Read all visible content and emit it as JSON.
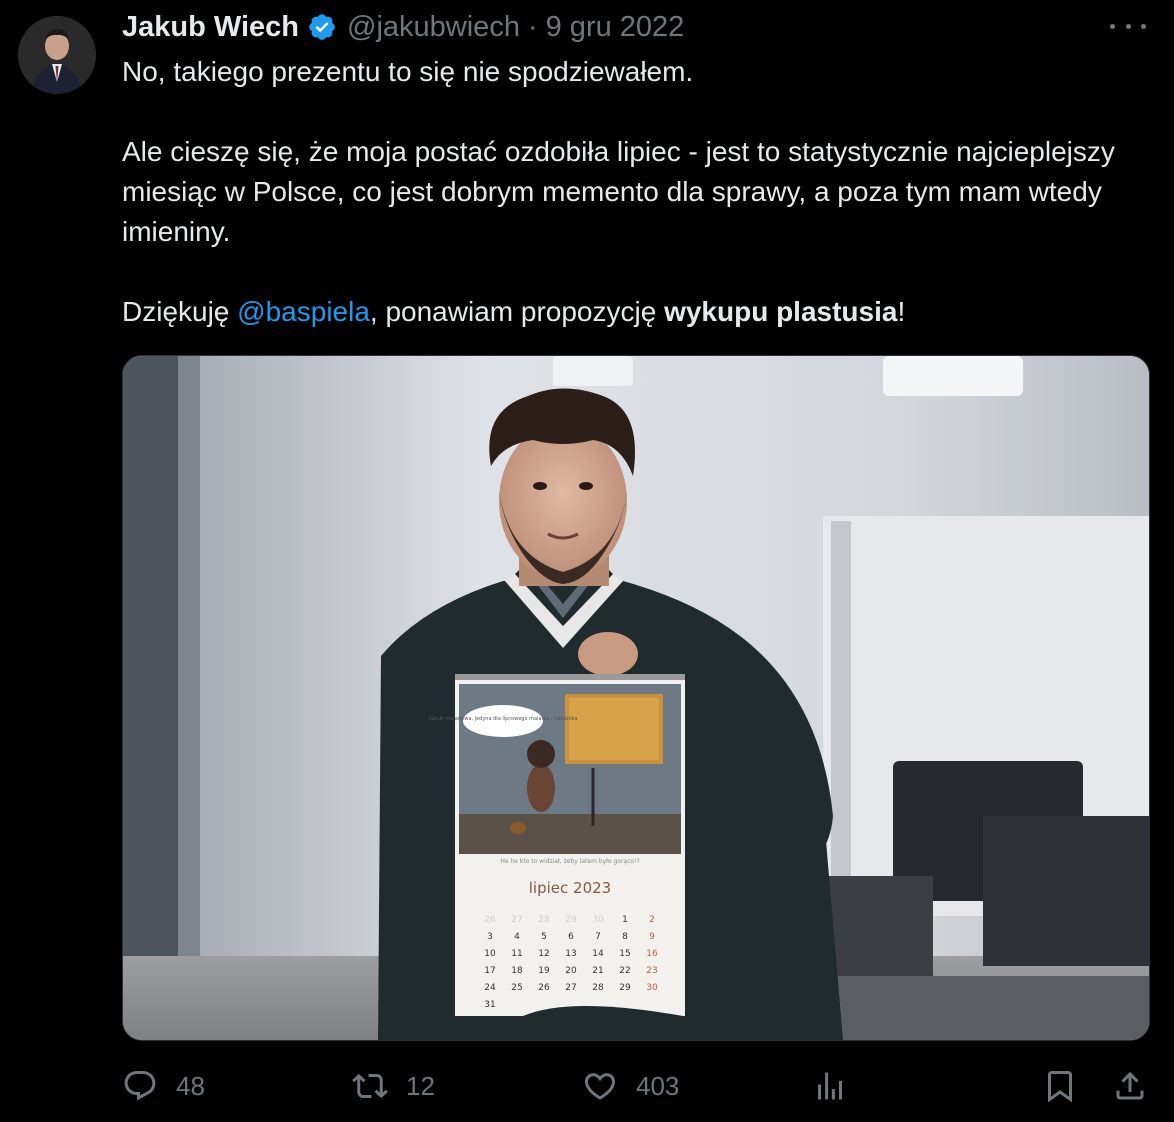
{
  "author": {
    "name": "Jakub Wiech",
    "handle": "@jakubwiech",
    "separator": "·",
    "date": "9 gru 2022",
    "verified_icon": "verified-badge-icon"
  },
  "tweet": {
    "line1": "No, takiego prezentu to się nie spodziewałem.",
    "para2": "Ale cieszę się, że moja postać ozdobiła lipiec - jest to statystycznie najcieplejszy miesiąc w Polsce, co jest dobrym memento dla sprawy, a poza tym mam wtedy imieniny.",
    "para3_before": "Dziękuję ",
    "mention": "@baspiela",
    "para3_middle": ", ponawiam propozycję ",
    "para3_bold": "wykupu plastusia",
    "para3_end": "!"
  },
  "calendar": {
    "month_title": "lipiec 2023",
    "subtitle": "He he kto to widział, żeby latem było gorąco!?",
    "speech": "Sztuki malarstwa, jedyna dla lipcowego malarza i robotnika",
    "rows": [
      [
        "26",
        "27",
        "28",
        "29",
        "30",
        "1",
        "2"
      ],
      [
        "3",
        "4",
        "5",
        "6",
        "7",
        "8",
        "9"
      ],
      [
        "10",
        "11",
        "12",
        "13",
        "14",
        "15",
        "16"
      ],
      [
        "17",
        "18",
        "19",
        "20",
        "21",
        "22",
        "23"
      ],
      [
        "24",
        "25",
        "26",
        "27",
        "28",
        "29",
        "30"
      ],
      [
        "31",
        "",
        "",
        "",
        "",
        "",
        ""
      ]
    ]
  },
  "actions": {
    "reply": {
      "icon": "reply-icon",
      "count": "48"
    },
    "retweet": {
      "icon": "retweet-icon",
      "count": "12"
    },
    "like": {
      "icon": "heart-icon",
      "count": "403"
    },
    "views": {
      "icon": "analytics-icon"
    },
    "bookmark": {
      "icon": "bookmark-icon"
    },
    "share": {
      "icon": "share-icon"
    }
  },
  "colors": {
    "background": "#000000",
    "text": "#e7e9ea",
    "muted": "#71767b",
    "link": "#1d9bf0",
    "verified": "#1d9bf0"
  }
}
